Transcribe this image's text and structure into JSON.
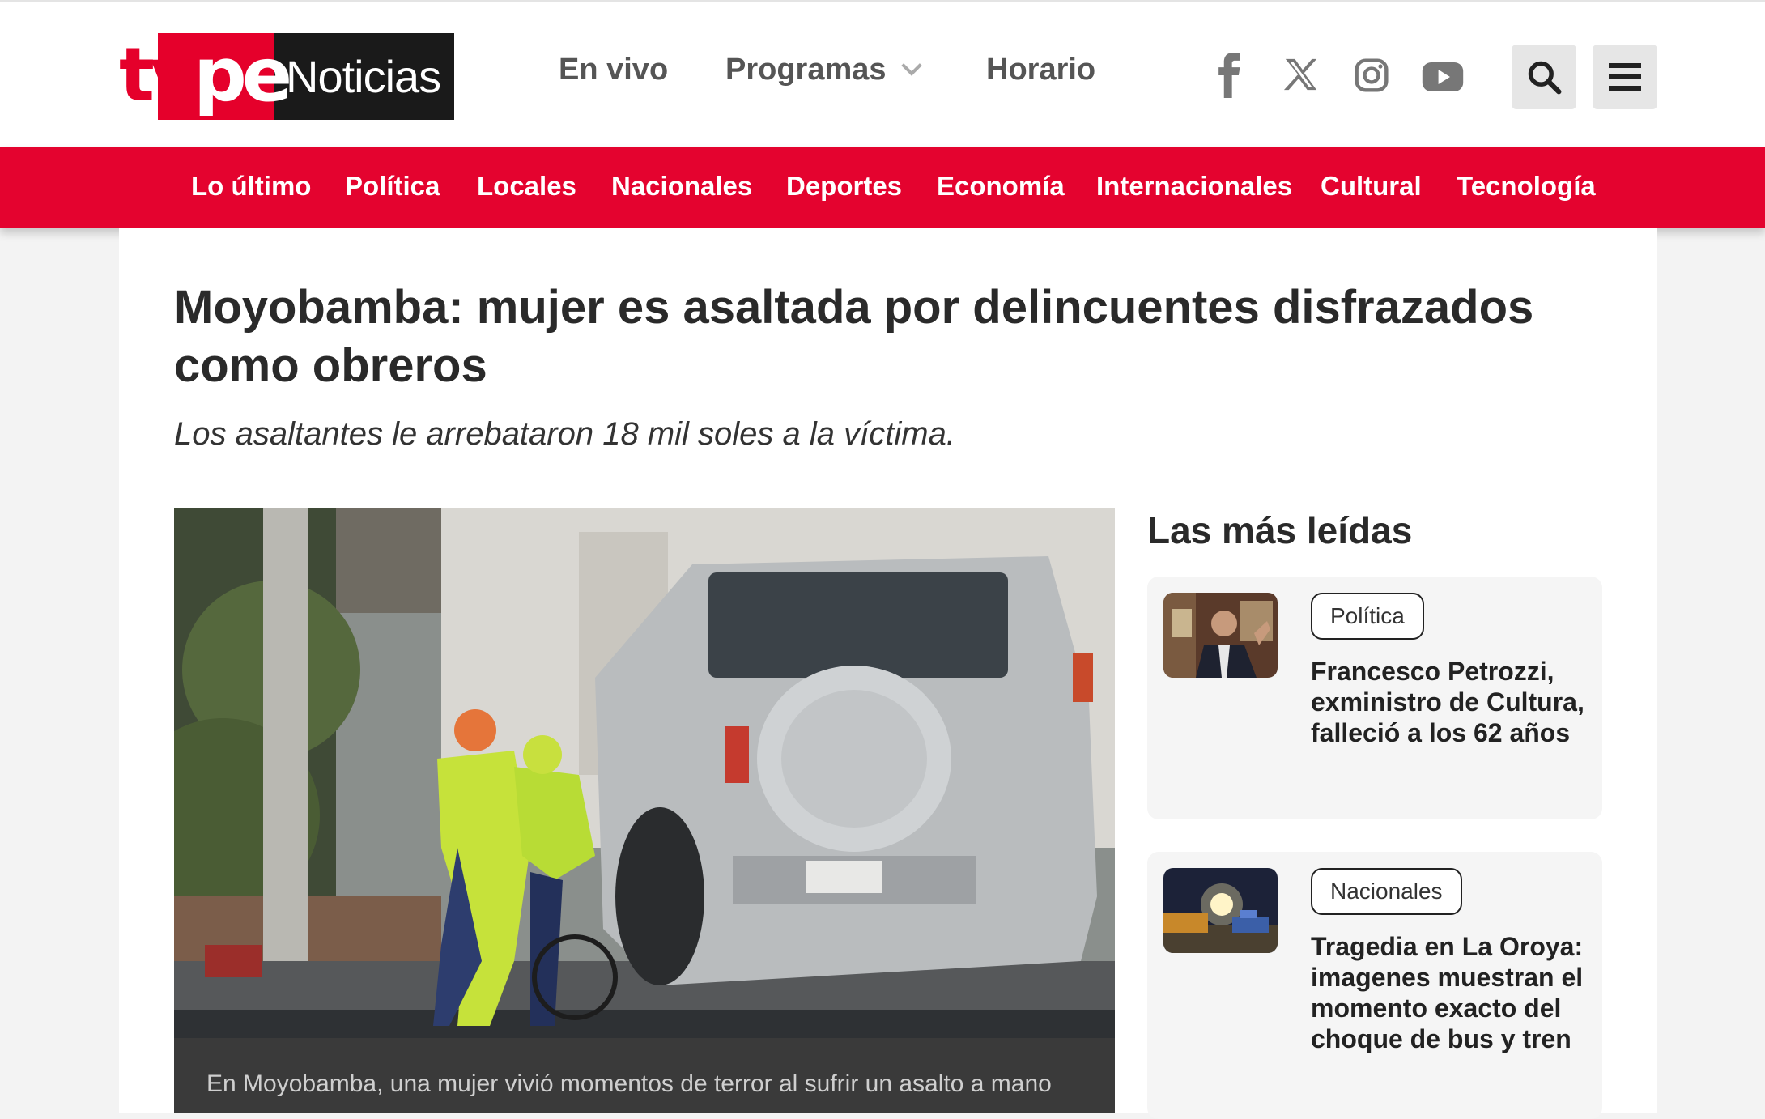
{
  "header": {
    "logo": {
      "brand": "tvpe",
      "section": "Noticias"
    },
    "nav": [
      {
        "label": "En vivo"
      },
      {
        "label": "Programas"
      },
      {
        "label": "Horario"
      }
    ],
    "social_icons": [
      "facebook-icon",
      "x-icon",
      "instagram-icon",
      "youtube-icon"
    ],
    "buttons": [
      "search-icon",
      "menu-icon"
    ]
  },
  "categories": [
    "Lo último",
    "Política",
    "Locales",
    "Nacionales",
    "Deportes",
    "Economía",
    "Internacionales",
    "Cultural",
    "Tecnología"
  ],
  "colors": {
    "brand_red": "#e4032f",
    "logo_dark": "#1a1a1a"
  },
  "article": {
    "title": "Moyobamba: mujer es asaltada por delincuentes disfrazados como obreros",
    "subtitle": "Los asaltantes le arrebataron 18 mil soles a la víctima.",
    "caption": "En Moyobamba, una mujer vivió momentos de terror al sufrir un asalto a mano"
  },
  "sidebar": {
    "title": "Las más leídas",
    "items": [
      {
        "tag": "Política",
        "title": "Francesco Petrozzi, exministro de Cultura, falleció a los 62 años"
      },
      {
        "tag": "Nacionales",
        "title": "Tragedia en La Oroya: imagenes muestran el momento exacto del choque de bus y tren"
      }
    ]
  }
}
